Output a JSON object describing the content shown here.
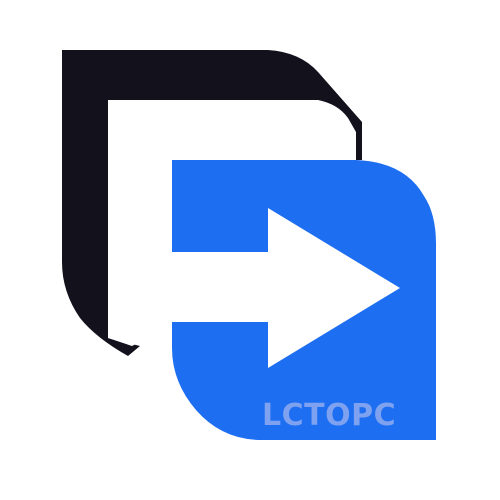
{
  "logo": {
    "icon_name": "file-transfer-arrow-icon",
    "colors": {
      "dark": "#12111c",
      "blue": "#1e6ef2",
      "white": "#ffffff"
    }
  },
  "watermark": {
    "text": "LCTOPC"
  }
}
